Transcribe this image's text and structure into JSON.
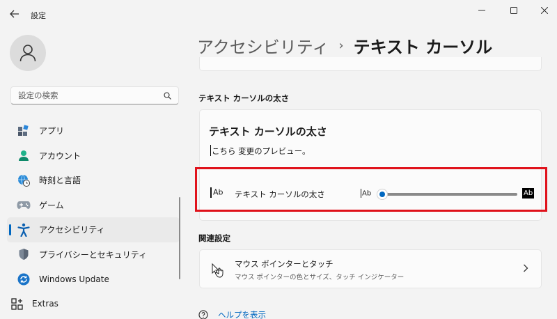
{
  "window": {
    "title": "設定",
    "controls": [
      "minimize-icon",
      "maximize-icon",
      "close-icon"
    ]
  },
  "sidebar": {
    "search_placeholder": "設定の検索",
    "items": [
      {
        "label": "アプリ",
        "icon": "apps-icon"
      },
      {
        "label": "アカウント",
        "icon": "account-icon"
      },
      {
        "label": "時刻と言語",
        "icon": "globe-clock-icon"
      },
      {
        "label": "ゲーム",
        "icon": "gamepad-icon"
      },
      {
        "label": "アクセシビリティ",
        "icon": "accessibility-icon",
        "selected": true
      },
      {
        "label": "プライバシーとセキュリティ",
        "icon": "shield-icon"
      },
      {
        "label": "Windows Update",
        "icon": "sync-icon"
      },
      {
        "label": "Extras",
        "icon": "extras-icon"
      }
    ]
  },
  "breadcrumb": {
    "parent": "アクセシビリティ",
    "separator": "›",
    "current": "テキスト カーソル"
  },
  "thickness_section": {
    "heading": "テキスト カーソルの太さ",
    "preview_title": "テキスト カーソルの太さ",
    "preview_text": "こちら 変更のプレビュー。",
    "setting_label": "テキスト カーソルの太さ",
    "icon_text": "Ab",
    "slider_min_label": "Ab",
    "slider_max_label": "Ab",
    "slider_value_fraction": 0
  },
  "related_section": {
    "heading": "関連設定",
    "item_title": "マウス ポインターとタッチ",
    "item_subtitle": "マウス ポインターの色とサイズ、タッチ インジケーター"
  },
  "help_link": "ヘルプを表示",
  "colors": {
    "accent": "#0067c0",
    "highlight": "#e0121b"
  }
}
